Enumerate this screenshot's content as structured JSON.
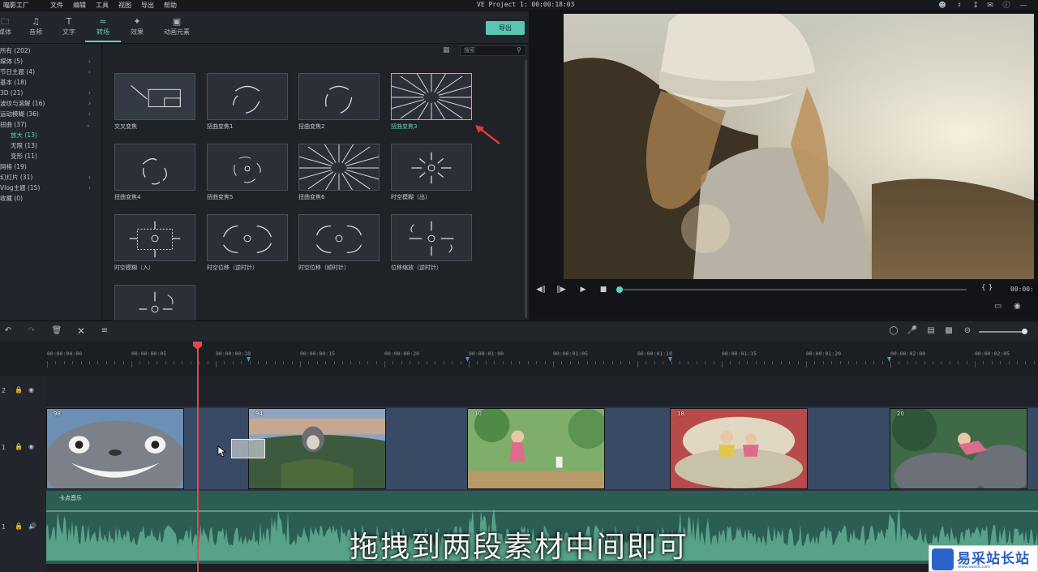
{
  "menubar": {
    "logo": "喵影工厂",
    "items": [
      "文件",
      "编辑",
      "工具",
      "视图",
      "导出",
      "帮助"
    ],
    "project_title": "VE Project 1: 00:00:18:03"
  },
  "tabs": [
    {
      "label": "媒体",
      "icon": "folder-icon"
    },
    {
      "label": "音频",
      "icon": "music-icon"
    },
    {
      "label": "文字",
      "icon": "text-icon"
    },
    {
      "label": "转场",
      "icon": "transition-icon",
      "active": true
    },
    {
      "label": "效果",
      "icon": "effects-icon"
    },
    {
      "label": "动画元素",
      "icon": "image-icon"
    }
  ],
  "export_label": "导出",
  "search_placeholder": "搜索",
  "categories": [
    {
      "label": "所有 (202)"
    },
    {
      "label": "媒体 (5)",
      "chev": "›"
    },
    {
      "label": "节日主题 (4)",
      "chev": "›"
    },
    {
      "label": "基本 (18)"
    },
    {
      "label": "3D (21)",
      "chev": "›"
    },
    {
      "label": "波纹与溶解 (16)",
      "chev": "›"
    },
    {
      "label": "运动模糊 (36)",
      "chev": "›"
    },
    {
      "label": "扭曲 (37)",
      "chev": "⌄"
    },
    {
      "label": "放大 (13)",
      "sub": true,
      "selected": true
    },
    {
      "label": "无限 (13)",
      "sub": true
    },
    {
      "label": "变形 (11)",
      "sub": true
    },
    {
      "label": "网格 (19)"
    },
    {
      "label": "幻灯片 (31)",
      "chev": "›"
    },
    {
      "label": "Vlog主题 (15)",
      "chev": "›"
    },
    {
      "label": "收藏 (0)"
    }
  ],
  "transitions": [
    "交叉变焦",
    "扭曲变焦1",
    "扭曲变焦2",
    "扭曲变焦3",
    "扭曲变焦4",
    "扭曲变焦5",
    "扭曲变焦6",
    "时空模糊（出）",
    "时空模糊（入）",
    "时空位移（逆时针）",
    "时空位移（顺时针）",
    "位移缩放（逆时针）",
    ""
  ],
  "selected_transition": "扭曲变焦3",
  "preview": {
    "timecode": "00:00:",
    "brackets": "{ }"
  },
  "ruler": {
    "labels": [
      "00:00:00:00",
      "00:00:00:05",
      "00:00:00:10",
      "00:00:00:15",
      "00:00:00:20",
      "00:00:01:00",
      "00:00:01:05",
      "00:00:01:10",
      "00:00:01:15",
      "00:00:01:20",
      "00:00:02:00",
      "00:00:02:05"
    ]
  },
  "tracks": {
    "v2": "2",
    "v1": "1",
    "a1": "1"
  },
  "clips": [
    "98",
    "94",
    "10",
    "18",
    "20"
  ],
  "audio_label": "卡点音乐",
  "subtitle": "拖拽到两段素材中间即可",
  "watermark": {
    "title": "易采站长站",
    "url": "www.easck.com"
  },
  "colors": {
    "accent": "#5fd1c0",
    "playhead": "#e24a4a",
    "audio": "#2c5d52"
  }
}
